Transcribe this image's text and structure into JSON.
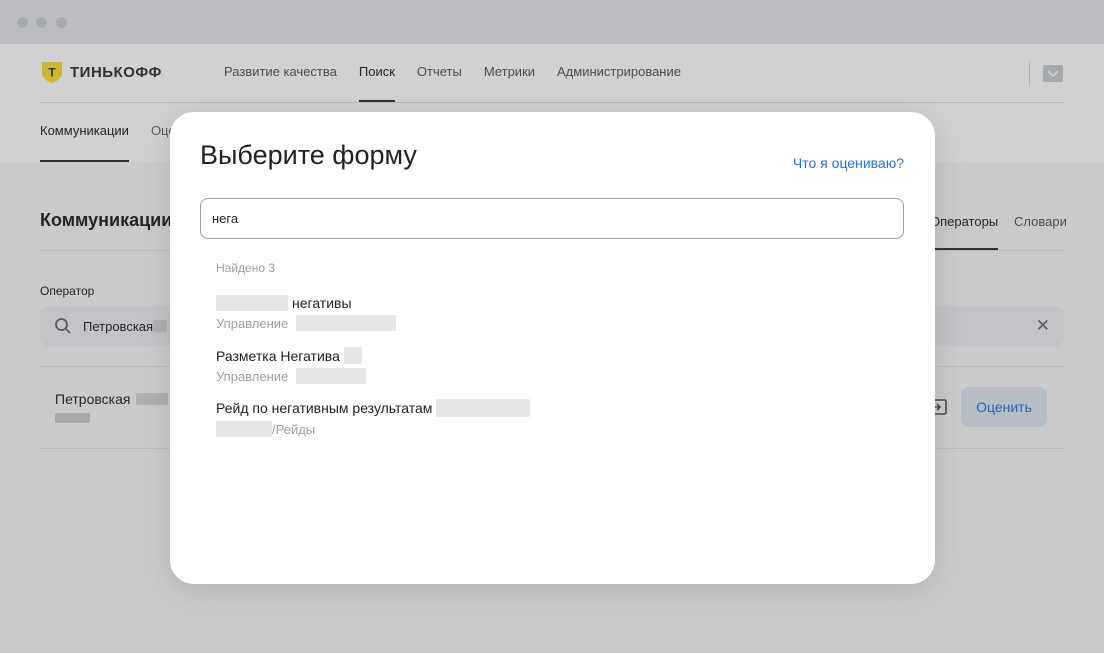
{
  "app": {
    "logo_text": "ТИНЬКОФФ",
    "logo_letter": "Т"
  },
  "colors": {
    "accent_link": "#2c6fd6",
    "logo_yellow": "#ffdd2d"
  },
  "topnav": {
    "items": [
      {
        "label": "Развитие качества",
        "active": false
      },
      {
        "label": "Поиск",
        "active": true
      },
      {
        "label": "Отчеты",
        "active": false
      },
      {
        "label": "Метрики",
        "active": false
      },
      {
        "label": "Администрирование",
        "active": false
      }
    ]
  },
  "subnav": {
    "items": [
      {
        "label": "Коммуникации",
        "active": true
      },
      {
        "label": "Оце",
        "active": false
      }
    ]
  },
  "main": {
    "section_title": "Коммуникации",
    "tabs": [
      "Операторы",
      "Словари"
    ],
    "operator_label": "Оператор",
    "operator_search_value": "Петровская",
    "result_name": "Петровская",
    "rate_button": "Оценить"
  },
  "modal": {
    "title": "Выберите форму",
    "help_link": "Что я оцениваю?",
    "search_value": "нега",
    "found_text": "Найдено 3",
    "results": [
      {
        "title": "негативы",
        "subtitle": "Управление"
      },
      {
        "title": "Разметка Негатива",
        "subtitle": "Управление"
      },
      {
        "title": "Рейд по негативным результатам",
        "subtitle": "/Рейды"
      }
    ]
  },
  "icons": [
    "search-icon",
    "close-icon",
    "enter-icon",
    "account-icon",
    "logo-shield-icon"
  ]
}
